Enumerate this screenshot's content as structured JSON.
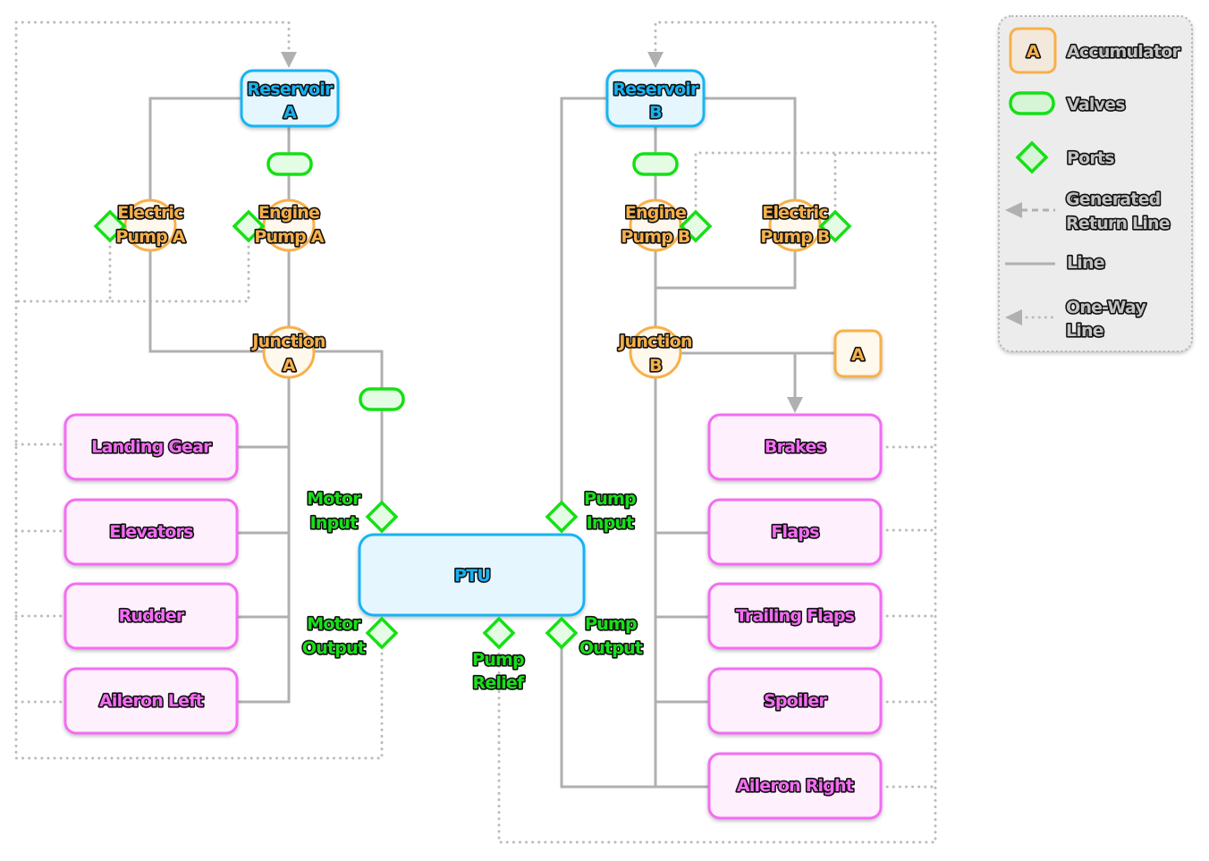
{
  "colors": {
    "reservoir": "#16b2f2",
    "pump": "#f7b04a",
    "port": "#18e018",
    "consumer": "#f46cf4",
    "line": "#b0b0b0"
  },
  "reservoirs": [
    {
      "line1": "Reservoir",
      "line2": "A"
    },
    {
      "line1": "Reservoir",
      "line2": "B"
    }
  ],
  "pumps": [
    {
      "line1": "Electric",
      "line2": "Pump A"
    },
    {
      "line1": "Engine",
      "line2": "Pump A"
    },
    {
      "line1": "Engine",
      "line2": "Pump B"
    },
    {
      "line1": "Electric",
      "line2": "Pump B"
    }
  ],
  "junctions": [
    {
      "line1": "Junction",
      "line2": "A"
    },
    {
      "line1": "Junction",
      "line2": "B"
    }
  ],
  "accumulator": "A",
  "ptu": {
    "label": "PTU",
    "ports": {
      "motor_input": [
        "Motor",
        "Input"
      ],
      "pump_input": [
        "Pump",
        "Input"
      ],
      "motor_output": [
        "Motor",
        "Output"
      ],
      "pump_output": [
        "Pump",
        "Output"
      ],
      "pump_relief": [
        "Pump",
        "Relief"
      ]
    }
  },
  "consumers_left": [
    "Landing Gear",
    "Elevators",
    "Rudder",
    "Aileron Left"
  ],
  "consumers_right": [
    "Brakes",
    "Flaps",
    "Trailing Flaps",
    "Spoiler",
    "Aileron Right"
  ],
  "legend": {
    "accumulator_symbol": "A",
    "accumulator": "Accumulator",
    "valves": "Valves",
    "ports": "Ports",
    "generated_return": [
      "Generated",
      "Return Line"
    ],
    "line": "Line",
    "one_way": [
      "One-Way",
      "Line"
    ]
  }
}
